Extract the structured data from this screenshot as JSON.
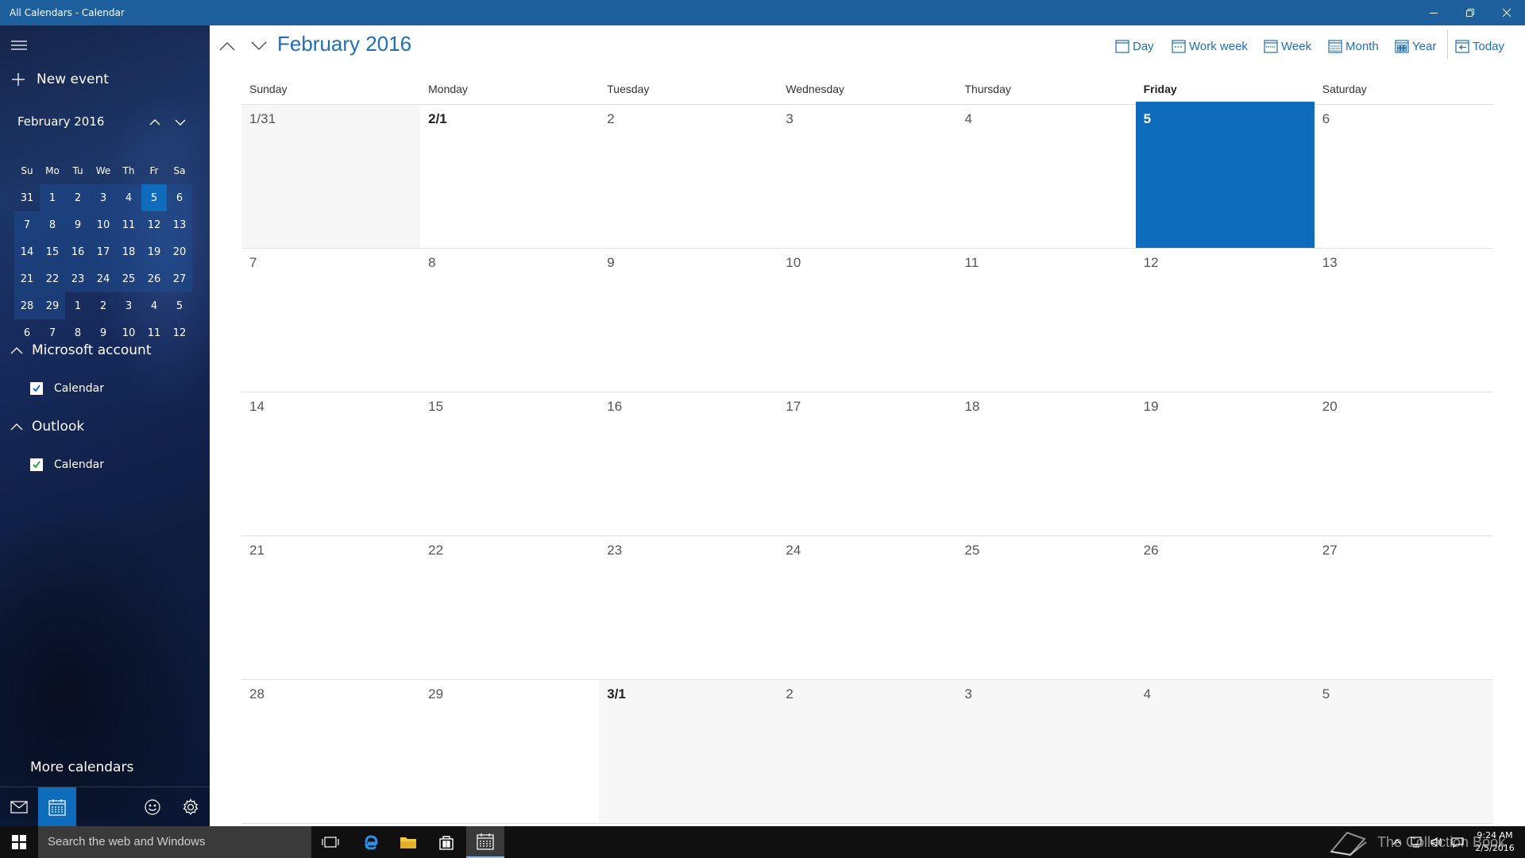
{
  "window": {
    "title": "All Calendars - Calendar"
  },
  "sidebar": {
    "new_event_label": "New event",
    "mini_calendar": {
      "title": "February 2016",
      "weekdays": [
        "Su",
        "Mo",
        "Tu",
        "We",
        "Th",
        "Fr",
        "Sa"
      ],
      "rows": [
        [
          "31",
          "1",
          "2",
          "3",
          "4",
          "5",
          "6"
        ],
        [
          "7",
          "8",
          "9",
          "10",
          "11",
          "12",
          "13"
        ],
        [
          "14",
          "15",
          "16",
          "17",
          "18",
          "19",
          "20"
        ],
        [
          "21",
          "22",
          "23",
          "24",
          "25",
          "26",
          "27"
        ],
        [
          "28",
          "29",
          "1",
          "2",
          "3",
          "4",
          "5"
        ],
        [
          "6",
          "7",
          "8",
          "9",
          "10",
          "11",
          "12"
        ]
      ]
    },
    "accounts": [
      {
        "name": "Microsoft account",
        "calendar": "Calendar",
        "color": "#1e6fd9"
      },
      {
        "name": "Outlook",
        "calendar": "Calendar",
        "color": "#2e9e3e"
      }
    ],
    "more_calendars_label": "More calendars"
  },
  "main": {
    "month_title": "February 2016",
    "views": {
      "day": "Day",
      "work_week": "Work week",
      "week": "Week",
      "month": "Month",
      "year": "Year",
      "today": "Today"
    },
    "weekdays": [
      "Sunday",
      "Monday",
      "Tuesday",
      "Wednesday",
      "Thursday",
      "Friday",
      "Saturday"
    ],
    "weeks": [
      [
        "1/31",
        "2/1",
        "2",
        "3",
        "4",
        "5",
        "6"
      ],
      [
        "7",
        "8",
        "9",
        "10",
        "11",
        "12",
        "13"
      ],
      [
        "14",
        "15",
        "16",
        "17",
        "18",
        "19",
        "20"
      ],
      [
        "21",
        "22",
        "23",
        "24",
        "25",
        "26",
        "27"
      ],
      [
        "28",
        "29",
        "3/1",
        "2",
        "3",
        "4",
        "5"
      ]
    ]
  },
  "taskbar": {
    "search_placeholder": "Search the web and Windows",
    "watermark": "The Collection Book",
    "time": "9:24 AM",
    "date": "2/5/2016"
  },
  "colors": {
    "accent": "#0f6cbd",
    "title_bar": "#1e5f9e",
    "month_title": "#1e6fb8"
  }
}
